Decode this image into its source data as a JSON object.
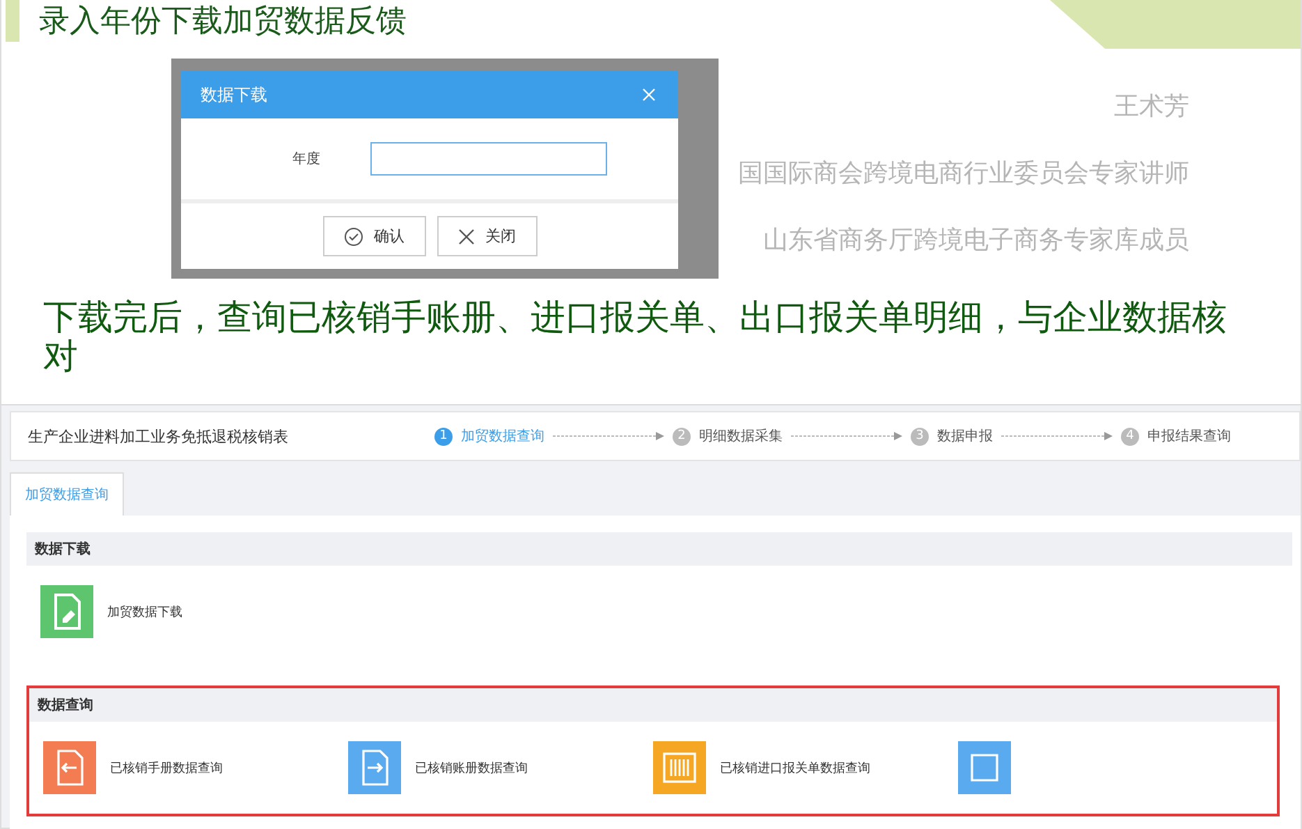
{
  "slide": {
    "title": "录入年份下载加贸数据反馈",
    "background_lines": [
      "王术芳",
      "国国际商会跨境电商行业委员会专家讲师",
      "山东省商务厅跨境电子商务专家库成员"
    ],
    "caption": "下载完后，查询已核销手账册、进口报关单、出口报关单明细，与企业数据核对"
  },
  "dialog": {
    "title": "数据下载",
    "field_label": "年度",
    "buttons": [
      {
        "kind": "confirm",
        "label": "确认"
      },
      {
        "kind": "close",
        "label": "关闭"
      }
    ]
  },
  "app": {
    "title": "生产企业进料加工业务免抵退税核销表",
    "steps": [
      {
        "number": "1",
        "label": "加贸数据查询",
        "selected": true
      },
      {
        "number": "2",
        "label": "明细数据采集",
        "selected": false
      },
      {
        "number": "3",
        "label": "数据申报",
        "selected": false
      },
      {
        "number": "4",
        "label": "申报结果查询",
        "selected": false
      }
    ],
    "tabs": [
      {
        "label": "加贸数据查询",
        "selected": true
      }
    ],
    "sections": [
      {
        "title": "数据下载",
        "highlighted": false,
        "items": [
          {
            "kind": "download",
            "label": "加贸数据下载"
          }
        ]
      },
      {
        "title": "数据查询",
        "highlighted": true,
        "items": [
          {
            "kind": "manual",
            "label": "已核销手册数据查询"
          },
          {
            "kind": "ledger",
            "label": "已核销账册数据查询"
          },
          {
            "kind": "import",
            "label": "已核销进口报关单数据查询"
          },
          {
            "kind": "export"
          }
        ]
      }
    ]
  }
}
